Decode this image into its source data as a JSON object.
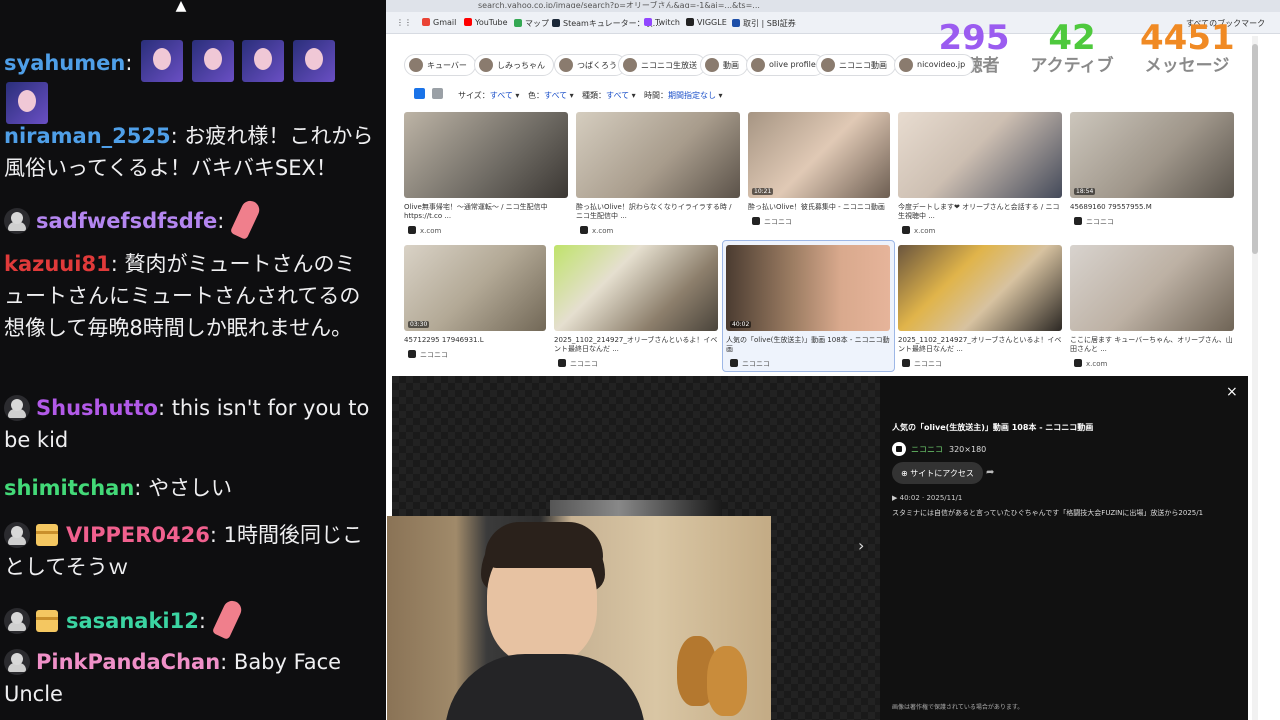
{
  "chat": {
    "messages": [
      {
        "user": "syahumen",
        "color": "#4f9fe8",
        "text": "",
        "emotes": 5
      },
      {
        "user": "niraman_2525",
        "color": "#4f9fe8",
        "text": "お疲れ様！これから風俗いってくるよ！バキバキSEX！"
      },
      {
        "user": "sadfwefsdfsdfe",
        "color": "#b486f0",
        "text": "",
        "pray": true
      },
      {
        "user": "kazuui81",
        "color": "#e03a3a",
        "text": "贅肉がミュートさんのミュートさんにミュートさんされてるの想像して毎晩8時間しか眠れません。"
      },
      {
        "user": "Shushutto",
        "color": "#b25ae8",
        "text": "this isn't for you to be kid"
      },
      {
        "user": "shimitchan",
        "color": "#43d978",
        "text": "やさしい"
      },
      {
        "user": "VIPPER0426",
        "color": "#f0608e",
        "text": "1時間後同じことしてそうｗ"
      },
      {
        "user": "sasanaki12",
        "color": "#3bd4a2",
        "text": "",
        "pray": true
      },
      {
        "user": "PinkPandaChan",
        "color": "#f090c8",
        "text": "Baby Face Uncle"
      }
    ]
  },
  "browser": {
    "url": "search.yahoo.co.jp/image/search?p=オリーブさん&aq=-1&ai=...&ts=...",
    "bookmarks": [
      "Gmail",
      "YouTube",
      "マップ",
      "Steamキュレーター：収...",
      "Twitch",
      "VIGGLE",
      "取引 | SBI証券",
      "すべてのブックマーク"
    ],
    "stats": {
      "viewers": {
        "value": "295",
        "label": "視聴者",
        "color": "#9b5cf0"
      },
      "active": {
        "value": "42",
        "label": "アクティブ",
        "color": "#4ec93d"
      },
      "messages": {
        "value": "4451",
        "label": "メッセージ",
        "color": "#f08a24"
      }
    },
    "chips": [
      "キューバー",
      "しみっちゃん",
      "つばくろう",
      "ニコニコ生放送",
      "動画",
      "olive profile",
      "ニコニコ動画",
      "nicovideo.jp"
    ],
    "filters": [
      {
        "label": "サイズ：",
        "value": "すべて"
      },
      {
        "label": "色：",
        "value": "すべて"
      },
      {
        "label": "種類：",
        "value": "すべて"
      },
      {
        "label": "時間：",
        "value": "期間指定なし"
      }
    ],
    "results": [
      {
        "caption": "Olive無事帰宅！～通常運転～ / ニコ生配信中 https://t.co ...",
        "source": "x.com",
        "dur": ""
      },
      {
        "caption": "酔っ払いOlive！訳わらなくなりイライラする時 / ニコ生配信中 ...",
        "source": "x.com",
        "dur": ""
      },
      {
        "caption": "酔っ払いOlive！彼氏募集中 - ニコニコ動画",
        "source": "ニコニコ",
        "dur": "10:21"
      },
      {
        "caption": "今度デートします❤ オリーブさんと会話する / ニコ生視聴中 ...",
        "source": "x.com",
        "dur": ""
      },
      {
        "caption": "45689160 79557955.M",
        "source": "ニコニコ",
        "dur": "18:54"
      },
      {
        "caption": "45712295 17946931.L",
        "source": "ニコニコ",
        "dur": "03:30"
      },
      {
        "caption": "2025_1102_214927_オリーブさんといるよ！イベント最終日なんだ ...",
        "source": "ニコニコ",
        "dur": ""
      },
      {
        "caption": "人気の「olive(生放送主)」動画 108本 - ニコニコ動画",
        "source": "ニコニコ",
        "dur": "40:02"
      },
      {
        "caption": "2025_1102_214927_オリーブさんといるよ！イベント最終日なんだ ...",
        "source": "ニコニコ",
        "dur": ""
      },
      {
        "caption": "ここに居ます キューバーちゃん、オリーブさん、山田さんと ...",
        "source": "x.com",
        "dur": ""
      }
    ],
    "preview": {
      "title": "人気の「olive(生放送主)」動画 108本 - ニコニコ動画",
      "source": "ニコニコ",
      "dims": "320×180",
      "visit": "サイトにアクセス",
      "date": "40:02 · 2025/11/1",
      "description": "スタミナには自信があると言っていたひぐちゃんです「格闘技大会FUZINに出場」放送から2025/1",
      "note": "画像は著作権で保護されている場合があります。",
      "close": "×",
      "next": "›"
    }
  }
}
